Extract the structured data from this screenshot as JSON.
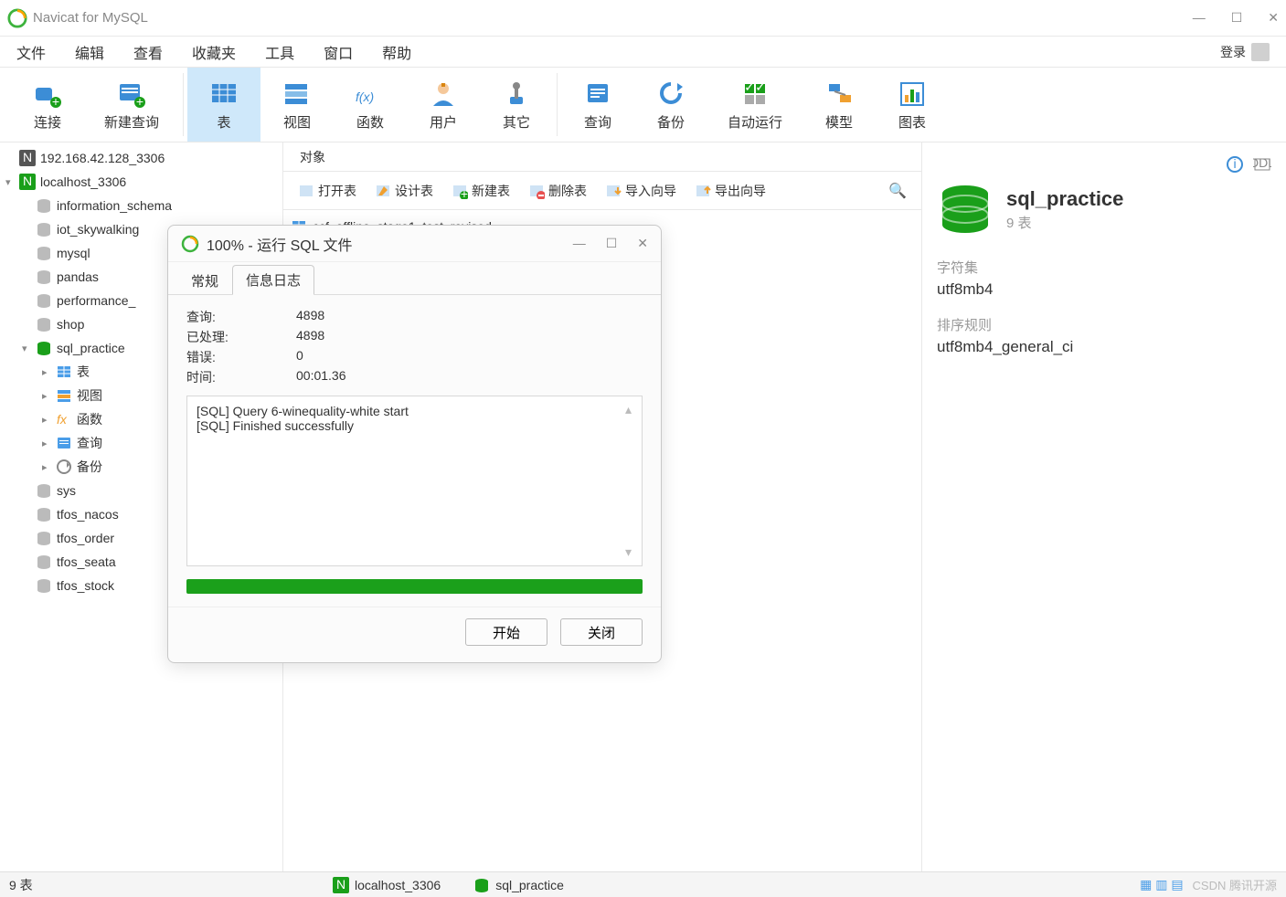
{
  "app": {
    "title": "Navicat for MySQL"
  },
  "win": {
    "min": "—",
    "max": "☐",
    "close": "✕"
  },
  "menu": [
    "文件",
    "编辑",
    "查看",
    "收藏夹",
    "工具",
    "窗口",
    "帮助"
  ],
  "login": {
    "label": "登录"
  },
  "toolbar": [
    {
      "id": "connect",
      "label": "连接"
    },
    {
      "id": "newquery",
      "label": "新建查询"
    },
    {
      "id": "table",
      "label": "表"
    },
    {
      "id": "view",
      "label": "视图"
    },
    {
      "id": "func",
      "label": "函数"
    },
    {
      "id": "user",
      "label": "用户"
    },
    {
      "id": "other",
      "label": "其它"
    },
    {
      "id": "query",
      "label": "查询"
    },
    {
      "id": "backup",
      "label": "备份"
    },
    {
      "id": "auto",
      "label": "自动运行"
    },
    {
      "id": "model",
      "label": "模型"
    },
    {
      "id": "chart",
      "label": "图表"
    }
  ],
  "tree": {
    "conn0": {
      "label": "192.168.42.128_3306"
    },
    "conn1": {
      "label": "localhost_3306",
      "expanded": true,
      "items": [
        {
          "label": "information_schema"
        },
        {
          "label": "iot_skywalking"
        },
        {
          "label": "mysql"
        },
        {
          "label": "pandas"
        },
        {
          "label": "performance_"
        },
        {
          "label": "shop"
        },
        {
          "label": "sql_practice",
          "expanded": true,
          "active": true,
          "children": [
            {
              "label": "表",
              "icon": "table"
            },
            {
              "label": "视图",
              "icon": "view"
            },
            {
              "label": "函数",
              "icon": "fx"
            },
            {
              "label": "查询",
              "icon": "query"
            },
            {
              "label": "备份",
              "icon": "backup"
            }
          ]
        },
        {
          "label": "sys"
        },
        {
          "label": "tfos_nacos"
        },
        {
          "label": "tfos_order"
        },
        {
          "label": "tfos_seata"
        },
        {
          "label": "tfos_stock"
        }
      ]
    }
  },
  "content": {
    "objectTab": "对象",
    "toolbar": [
      {
        "id": "open",
        "label": "打开表"
      },
      {
        "id": "design",
        "label": "设计表"
      },
      {
        "id": "new",
        "label": "新建表"
      },
      {
        "id": "delete",
        "label": "删除表"
      },
      {
        "id": "import",
        "label": "导入向导"
      },
      {
        "id": "export",
        "label": "导出向导"
      }
    ],
    "objects": [
      "ccf_offline_stage1_test_revised"
    ]
  },
  "rightpane": {
    "title": "sql_practice",
    "sub": "9 表",
    "charset": {
      "label": "字符集",
      "value": "utf8mb4"
    },
    "collation": {
      "label": "排序规则",
      "value": "utf8mb4_general_ci"
    }
  },
  "statusbar": {
    "left": "9 表",
    "conn": "localhost_3306",
    "db": "sql_practice",
    "watermark": "CSDN 腾讯开源"
  },
  "dialog": {
    "title": "100% - 运行 SQL 文件",
    "tabs": [
      "常规",
      "信息日志"
    ],
    "activeTab": 1,
    "stats": {
      "queryLabel": "查询:",
      "queryVal": "4898",
      "procLabel": "已处理:",
      "procVal": "4898",
      "errLabel": "错误:",
      "errVal": "0",
      "timeLabel": "时间:",
      "timeVal": "00:01.36"
    },
    "log": [
      "[SQL] Query 6-winequality-white start",
      "[SQL] Finished successfully"
    ],
    "buttons": {
      "start": "开始",
      "close": "关闭"
    }
  }
}
